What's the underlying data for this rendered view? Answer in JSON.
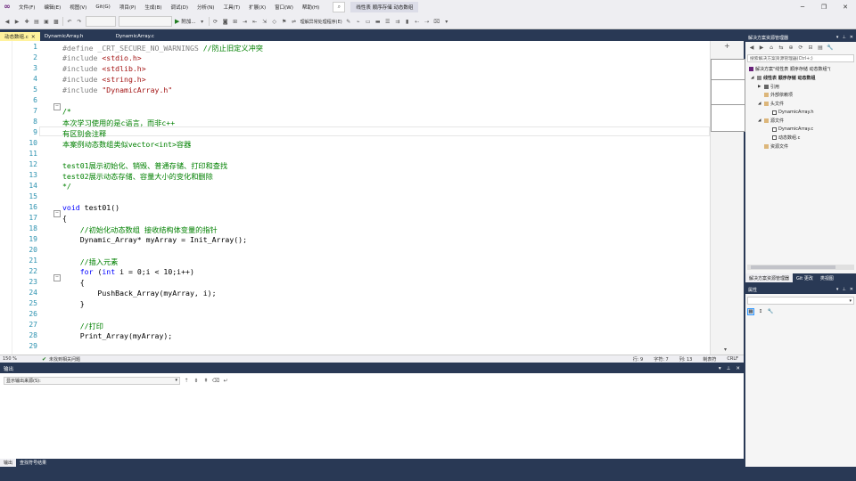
{
  "app": {
    "menu": [
      "文件(F)",
      "编辑(E)",
      "视图(V)",
      "Git(G)",
      "项目(P)",
      "生成(B)",
      "调试(D)",
      "分析(N)",
      "工具(T)",
      "扩展(X)",
      "窗口(W)",
      "帮助(H)"
    ],
    "search_icon": "search-icon",
    "solution_title": "线性表 顺序存储 动态数组",
    "window_controls": [
      "─",
      "❐",
      "✕"
    ]
  },
  "toolbar": {
    "run_label": "附加...",
    "extra_text": "理解异常处理程序(E)"
  },
  "tabs": [
    {
      "label": "动态数组.c",
      "active": true
    },
    {
      "label": "DynamicArray.h",
      "active": false
    },
    {
      "label": "DynamicArray.c",
      "active": false
    }
  ],
  "editor": {
    "lines": [
      {
        "n": "1",
        "code": "#define _CRT_SECURE_NO_WARNINGS //防止旧定义冲突"
      },
      {
        "n": "2",
        "code": "#include <stdio.h>"
      },
      {
        "n": "3",
        "code": "#include <stdlib.h>"
      },
      {
        "n": "4",
        "code": "#include <string.h>"
      },
      {
        "n": "5",
        "code": "#include \"DynamicArray.h\""
      },
      {
        "n": "6",
        "code": ""
      },
      {
        "n": "7",
        "code": "/*"
      },
      {
        "n": "8",
        "code": "本次学习使用的是c语言，而非c++"
      },
      {
        "n": "9",
        "code": "有区别会注释"
      },
      {
        "n": "10",
        "code": "本案例动态数组类似vector<int>容器"
      },
      {
        "n": "11",
        "code": ""
      },
      {
        "n": "12",
        "code": "test01展示初始化、销毁、普通存储、打印和查找"
      },
      {
        "n": "13",
        "code": "test02展示动态存储、容量大小的变化和删除"
      },
      {
        "n": "14",
        "code": "*/"
      },
      {
        "n": "15",
        "code": ""
      },
      {
        "n": "16",
        "code": "void test01()"
      },
      {
        "n": "17",
        "code": "{"
      },
      {
        "n": "18",
        "code": "    //初始化动态数组 接收结构体变量的指针"
      },
      {
        "n": "19",
        "code": "    Dynamic_Array* myArray = Init_Array();"
      },
      {
        "n": "20",
        "code": ""
      },
      {
        "n": "21",
        "code": "    //插入元素"
      },
      {
        "n": "22",
        "code": "    for (int i = 0;i < 10;i++)"
      },
      {
        "n": "23",
        "code": "    {"
      },
      {
        "n": "24",
        "code": "        PushBack_Array(myArray, i);"
      },
      {
        "n": "25",
        "code": "    }"
      },
      {
        "n": "26",
        "code": ""
      },
      {
        "n": "27",
        "code": "    //打印"
      },
      {
        "n": "28",
        "code": "    Print_Array(myArray);"
      },
      {
        "n": "29",
        "code": ""
      }
    ]
  },
  "editor_status": {
    "zoom": "150 %",
    "issues": "未找到相关问题",
    "line": "行: 9",
    "char": "字符: 7",
    "col": "列: 13",
    "tabs": "制表符",
    "eol": "CRLF"
  },
  "output": {
    "title": "输出",
    "source_label": "显示输出来源(S):",
    "tabs": [
      "输出",
      "查找符号结果"
    ]
  },
  "solution_explorer": {
    "title": "解决方案资源管理器",
    "search_placeholder": "搜索解决方案资源管理器(Ctrl+;)",
    "solution_label": "解决方案\"线性表 顺序存储 动态数组\"(",
    "project": "线性表 顺序存储 动态数组",
    "items": [
      {
        "label": "引用",
        "icon": "ref"
      },
      {
        "label": "外部依赖项",
        "icon": "folder"
      },
      {
        "label": "头文件",
        "icon": "folder"
      },
      {
        "label": "DynamicArray.h",
        "icon": "file"
      },
      {
        "label": "源文件",
        "icon": "folder"
      },
      {
        "label": "DynamicArray.c",
        "icon": "file"
      },
      {
        "label": "动态数组.c",
        "icon": "file"
      },
      {
        "label": "资源文件",
        "icon": "folder"
      }
    ],
    "tabs": [
      "解决方案资源管理器",
      "Git 更改",
      "类视图"
    ]
  },
  "properties": {
    "title": "属性"
  },
  "colors": {
    "chrome": "#293955",
    "active_tab": "#fff29d",
    "keyword": "#0000ff",
    "preprocessor": "#808080",
    "string": "#a31515",
    "comment": "#008000",
    "line_number": "#2b91af"
  }
}
